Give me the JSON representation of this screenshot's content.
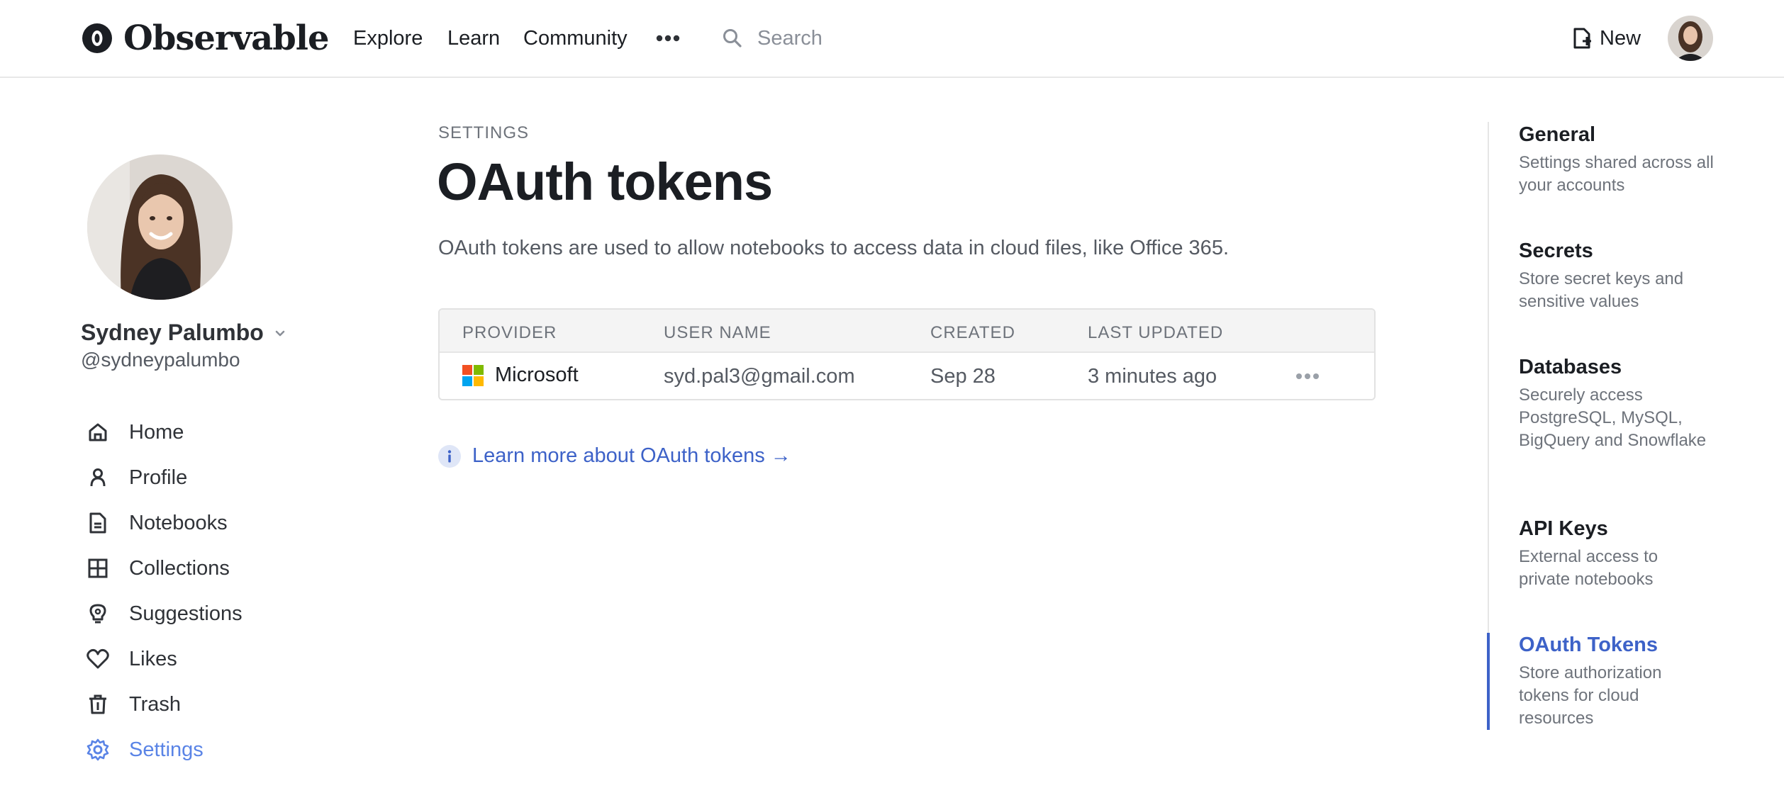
{
  "header": {
    "logo_text": "Observable",
    "nav": [
      "Explore",
      "Learn",
      "Community"
    ],
    "more_icon": "ellipsis-icon",
    "search_placeholder": "Search",
    "new_label": "New"
  },
  "profile": {
    "name": "Sydney Palumbo",
    "handle": "@sydneypalumbo"
  },
  "sidebar": {
    "items": [
      {
        "label": "Home",
        "icon": "home-icon"
      },
      {
        "label": "Profile",
        "icon": "person-icon"
      },
      {
        "label": "Notebooks",
        "icon": "document-icon"
      },
      {
        "label": "Collections",
        "icon": "grid-icon"
      },
      {
        "label": "Suggestions",
        "icon": "lightbulb-icon"
      },
      {
        "label": "Likes",
        "icon": "heart-icon"
      },
      {
        "label": "Trash",
        "icon": "trash-icon"
      },
      {
        "label": "Settings",
        "icon": "gear-icon",
        "active": true
      }
    ]
  },
  "main": {
    "eyebrow": "SETTINGS",
    "title": "OAuth tokens",
    "description": "OAuth tokens are used to allow notebooks to access data in cloud files, like Office 365.",
    "table": {
      "columns": [
        "PROVIDER",
        "USER NAME",
        "CREATED",
        "LAST UPDATED"
      ],
      "rows": [
        {
          "provider": "Microsoft",
          "user_name": "syd.pal3@gmail.com",
          "created": "Sep 28",
          "last_updated": "3 minutes ago"
        }
      ]
    },
    "learn_more": "Learn more about OAuth tokens →"
  },
  "settings_nav": {
    "items": [
      {
        "title": "General",
        "desc": "Settings shared across all your accounts"
      },
      {
        "title": "Secrets",
        "desc": "Store secret keys and sensitive values"
      },
      {
        "title": "Databases",
        "desc": "Securely access PostgreSQL, MySQL, BigQuery and Snowflake"
      },
      {
        "title": "API Keys",
        "desc": "External access to private notebooks"
      },
      {
        "title": "OAuth Tokens",
        "desc": "Store authorization tokens for cloud resources",
        "active": true
      }
    ]
  },
  "colors": {
    "accent": "#3d62c8",
    "active_sidebar": "#5a84e6",
    "text": "#1b1e23",
    "muted": "#6e737b"
  }
}
